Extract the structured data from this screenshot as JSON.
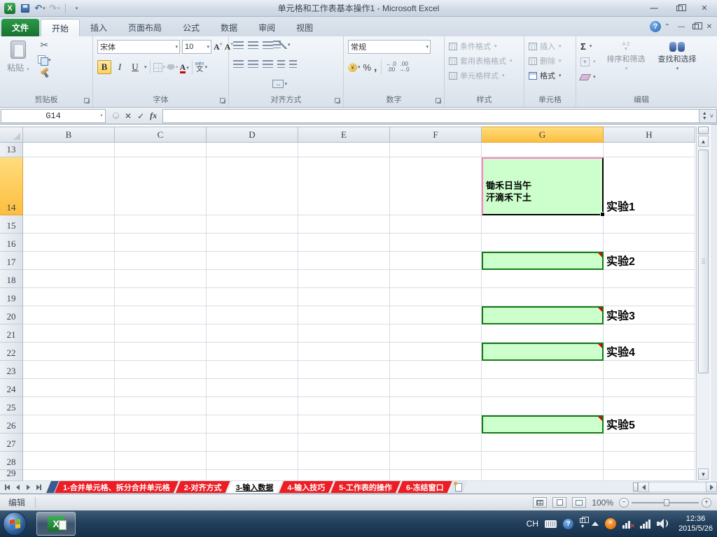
{
  "window": {
    "title": "单元格和工作表基本操作1 - Microsoft Excel"
  },
  "ribbon": {
    "file_tab": "文件",
    "tabs": [
      {
        "label": "开始",
        "active": true
      },
      {
        "label": "插入",
        "active": false
      },
      {
        "label": "页面布局",
        "active": false
      },
      {
        "label": "公式",
        "active": false
      },
      {
        "label": "数据",
        "active": false
      },
      {
        "label": "审阅",
        "active": false
      },
      {
        "label": "视图",
        "active": false
      }
    ],
    "clipboard": {
      "label": "剪贴板",
      "paste": "粘贴"
    },
    "font": {
      "label": "字体",
      "name": "宋体",
      "size": "10",
      "bold": "B",
      "italic": "I",
      "underline": "U",
      "phonetic_pinyin": "wén",
      "phonetic_char": "文"
    },
    "alignment": {
      "label": "对齐方式",
      "merge_glyph": "↔"
    },
    "number": {
      "label": "数字",
      "format": "常规",
      "currency_glyph": "¥",
      "percent": "%",
      "comma": ",",
      "dec_add_top": "←.0",
      "dec_add_bot": ".00",
      "dec_del_top": ".00",
      "dec_del_bot": "→.0"
    },
    "styles": {
      "label": "样式",
      "conditional": "条件格式",
      "format_table": "套用表格格式",
      "cell_styles": "单元格样式"
    },
    "cells": {
      "label": "单元格",
      "insert": "插入",
      "delete": "删除",
      "format": "格式"
    },
    "editing": {
      "label": "编辑",
      "autosum": "Σ",
      "az": "A Z",
      "sort_filter": "排序和筛选",
      "find_select": "查找和选择"
    }
  },
  "formula_bar": {
    "name_box": "G14",
    "cancel": "✕",
    "enter": "✓",
    "fx": "fx",
    "value": ""
  },
  "grid": {
    "columns": [
      {
        "label": "B",
        "selected": false
      },
      {
        "label": "C",
        "selected": false
      },
      {
        "label": "D",
        "selected": false
      },
      {
        "label": "E",
        "selected": false
      },
      {
        "label": "F",
        "selected": false
      },
      {
        "label": "G",
        "selected": true
      },
      {
        "label": "H",
        "selected": false
      }
    ],
    "rows": [
      {
        "label": "13",
        "selected": false
      },
      {
        "label": "14",
        "selected": true
      },
      {
        "label": "15",
        "selected": false
      },
      {
        "label": "16",
        "selected": false
      },
      {
        "label": "17",
        "selected": false
      },
      {
        "label": "18",
        "selected": false
      },
      {
        "label": "19",
        "selected": false
      },
      {
        "label": "20",
        "selected": false
      },
      {
        "label": "21",
        "selected": false
      },
      {
        "label": "22",
        "selected": false
      },
      {
        "label": "23",
        "selected": false
      },
      {
        "label": "24",
        "selected": false
      },
      {
        "label": "25",
        "selected": false
      },
      {
        "label": "26",
        "selected": false
      },
      {
        "label": "27",
        "selected": false
      },
      {
        "label": "28",
        "selected": false
      },
      {
        "label": "29",
        "selected": false
      }
    ],
    "poem_cell": {
      "line1": "锄禾日当午",
      "line2": "汗滴禾下土"
    },
    "experiments": [
      "实验1",
      "实验2",
      "实验3",
      "实验4",
      "实验5"
    ]
  },
  "sheet_tabs": {
    "tabs": [
      {
        "label": "1-合并单元格、拆分合并单元格",
        "active": false
      },
      {
        "label": "2-对齐方式",
        "active": false
      },
      {
        "label": "3-输入数据",
        "active": true
      },
      {
        "label": "4-输入技巧",
        "active": false
      },
      {
        "label": "5-工作表的操作",
        "active": false
      },
      {
        "label": "6-冻结窗口",
        "active": false
      }
    ]
  },
  "status_bar": {
    "mode": "编辑",
    "zoom_level": "100%"
  },
  "taskbar": {
    "language": "CH",
    "time": "12:36",
    "date": "2015/5/26"
  },
  "colors": {
    "cell_fill_green": "#ccffcc",
    "cell_border_green": "#157a15",
    "comment_red": "#e00000",
    "edit_border_pink": "#ff82c4",
    "tab_red": "#ee1c23",
    "file_tab_green": "#2b9a45",
    "selected_header": "#fcbe3f",
    "taskbar_blue": "#16304b"
  }
}
